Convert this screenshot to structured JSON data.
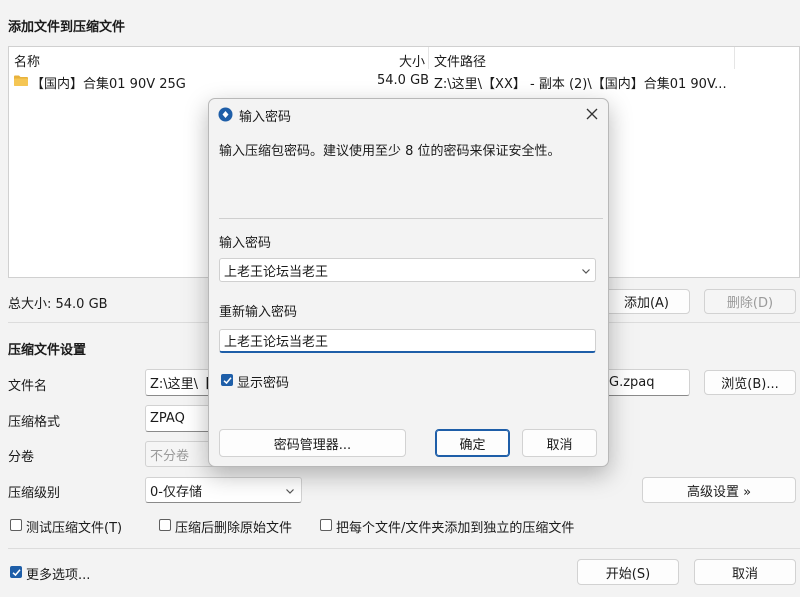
{
  "window": {
    "title": "添加文件到压缩文件"
  },
  "file_list": {
    "columns": {
      "name": "名称",
      "size": "大小",
      "path": "文件路径"
    },
    "rows": [
      {
        "name": "【国内】合集01 90V 25G",
        "size": "54.0 GB",
        "path": "Z:\\这里\\【XX】 - 副本 (2)\\【国内】合集01 90V..."
      }
    ]
  },
  "total_size": "总大小: 54.0 GB",
  "list_buttons": {
    "add": "添加(A)",
    "remove": "删除(D)"
  },
  "settings": {
    "section_title": "压缩文件设置",
    "filename_label": "文件名",
    "filename_value": "Z:\\这里\\【",
    "filename_suffix": "G.zpaq",
    "browse": "浏览(B)...",
    "format_label": "压缩格式",
    "format_value": "ZPAQ",
    "split_label": "分卷",
    "split_value": "不分卷",
    "level_label": "压缩级别",
    "level_value": "0-仅存储",
    "advanced": "高级设置 »"
  },
  "options": {
    "test": "测试压缩文件(T)",
    "delete_after": "压缩后删除原始文件",
    "separate": "把每个文件/文件夹添加到独立的压缩文件"
  },
  "footer": {
    "more_options": "更多选项...",
    "start": "开始(S)",
    "cancel": "取消"
  },
  "dialog": {
    "title": "输入密码",
    "description": "输入压缩包密码。建议使用至少 8 位的密码来保证安全性。",
    "password_label": "输入密码",
    "password_value": "上老王论坛当老王",
    "confirm_label": "重新输入密码",
    "confirm_value": "上老王论坛当老王",
    "show_password": "显示密码",
    "manager": "密码管理器...",
    "ok": "确定",
    "cancel": "取消"
  },
  "colors": {
    "accent": "#1e5ea8",
    "folder": "#e8b23c"
  }
}
